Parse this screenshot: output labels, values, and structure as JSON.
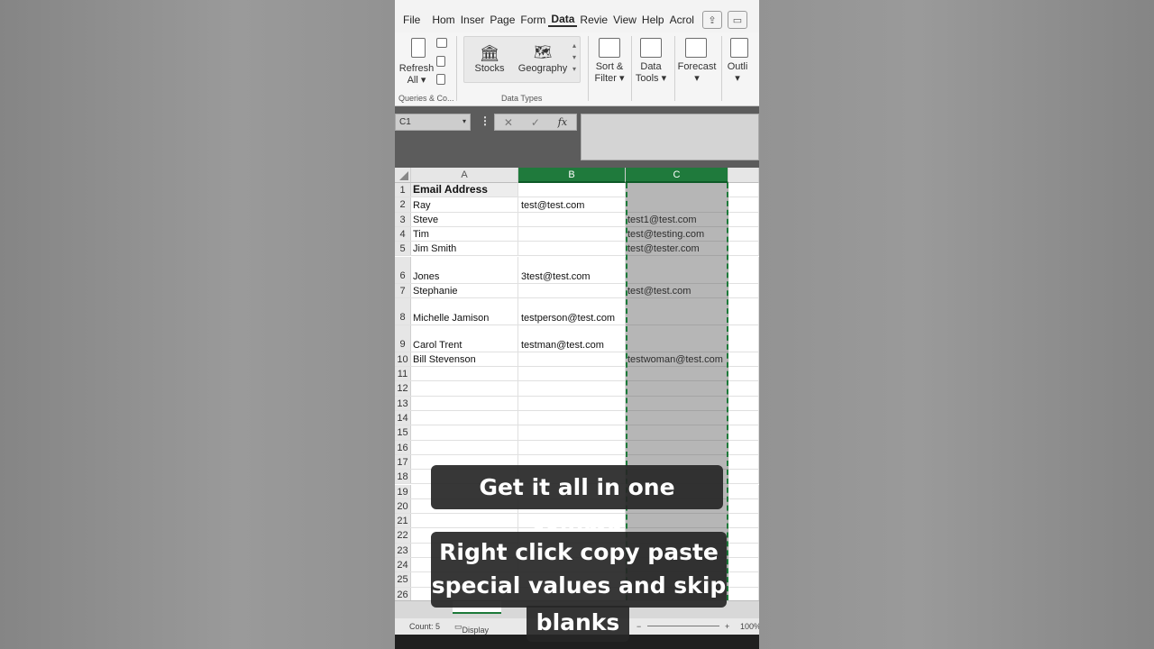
{
  "menu": {
    "tabs": [
      "File",
      "Hom",
      "Inser",
      "Page",
      "Form",
      "Data",
      "Revie",
      "View",
      "Help",
      "Acrol"
    ],
    "active": "Data"
  },
  "ribbon": {
    "refresh_label": "Refresh",
    "refresh_all": "All",
    "queries_group": "Queries & Co...",
    "stocks": "Stocks",
    "geography": "Geography",
    "data_types_group": "Data Types",
    "sort_filter": "Sort &",
    "sort_filter_2": "Filter",
    "data_tools": "Data",
    "data_tools_2": "Tools",
    "forecast": "Forecast",
    "outline": "Outli"
  },
  "formula_bar": {
    "name_box": "C1",
    "dots": "⋮",
    "cancel": "✕",
    "enter": "✓",
    "fx": "fx"
  },
  "columns": [
    "A",
    "B",
    "C"
  ],
  "rows": [
    {
      "n": "1",
      "a": "Email Address",
      "b": "",
      "c": ""
    },
    {
      "n": "2",
      "a": "Ray",
      "b": "test@test.com",
      "c": ""
    },
    {
      "n": "3",
      "a": "Steve",
      "b": "",
      "c": "test1@test.com"
    },
    {
      "n": "4",
      "a": "Tim",
      "b": "",
      "c": "test@testing.com"
    },
    {
      "n": "5",
      "a": "Jim Smith",
      "b": "",
      "c": "test@tester.com"
    },
    {
      "n": "6",
      "a": "Jones",
      "b": "3test@test.com",
      "c": ""
    },
    {
      "n": "7",
      "a": "Stephanie",
      "b": "",
      "c": "test@test.com"
    },
    {
      "n": "8",
      "a": "Michelle Jamison",
      "b": "testperson@test.com",
      "c": ""
    },
    {
      "n": "9",
      "a": "Carol Trent",
      "b": "testman@test.com",
      "c": ""
    },
    {
      "n": "10",
      "a": "Bill Stevenson",
      "b": "",
      "c": "testwoman@test.com"
    },
    {
      "n": "11",
      "a": "",
      "b": "",
      "c": ""
    },
    {
      "n": "12",
      "a": "",
      "b": "",
      "c": ""
    },
    {
      "n": "13",
      "a": "",
      "b": "",
      "c": ""
    },
    {
      "n": "14",
      "a": "",
      "b": "",
      "c": ""
    },
    {
      "n": "15",
      "a": "",
      "b": "",
      "c": ""
    },
    {
      "n": "16",
      "a": "",
      "b": "",
      "c": ""
    },
    {
      "n": "17",
      "a": "",
      "b": "",
      "c": ""
    },
    {
      "n": "18",
      "a": "",
      "b": "",
      "c": ""
    },
    {
      "n": "19",
      "a": "",
      "b": "",
      "c": ""
    },
    {
      "n": "20",
      "a": "",
      "b": "",
      "c": ""
    },
    {
      "n": "21",
      "a": "",
      "b": "",
      "c": ""
    },
    {
      "n": "22",
      "a": "",
      "b": "",
      "c": ""
    },
    {
      "n": "23",
      "a": "",
      "b": "",
      "c": ""
    },
    {
      "n": "24",
      "a": "",
      "b": "",
      "c": ""
    },
    {
      "n": "25",
      "a": "",
      "b": "",
      "c": ""
    },
    {
      "n": "26",
      "a": "",
      "b": "",
      "c": ""
    }
  ],
  "status": {
    "count": "Count: 5",
    "display_settings": "Display Settings",
    "zoom": "100%"
  },
  "captions": {
    "top": "Get it all in one column",
    "bottom_lines": [
      "Right click copy paste",
      "special values and skip",
      "blanks"
    ]
  }
}
